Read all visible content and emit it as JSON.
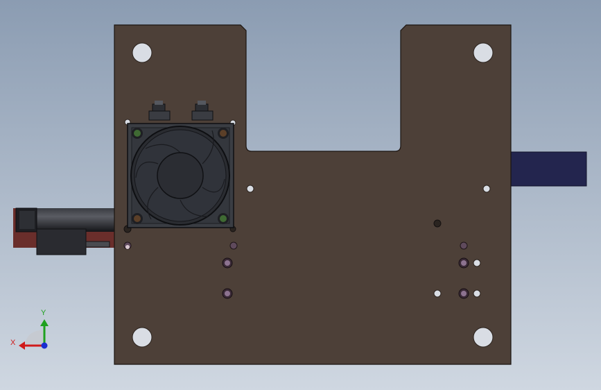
{
  "viewport": {
    "background_top": "#8b9cb2",
    "background_bottom": "#cfd7e1"
  },
  "colors": {
    "plate": "#4d4038",
    "plate_edge": "#1b1410",
    "hole": "#d9dde4",
    "fan_body": "#3a3d43",
    "fan_dark": "#2a2c31",
    "fan_ring": "#0e0f12",
    "fan_screw_green": "#3f6a33",
    "fan_screw_brown": "#5b3f28",
    "counterbore": "#5f4a5c",
    "cylinder": "#25262b",
    "cylinder_base": "#6a2e2b",
    "side_block": "#23254e",
    "axis_x": "#d01a1a",
    "axis_y": "#1fa11f",
    "axis_z": "#1a2ed0"
  },
  "triad": {
    "x_label": "X",
    "y_label": "Y"
  },
  "icons": {
    "triad": "coordinate-triad-icon"
  }
}
